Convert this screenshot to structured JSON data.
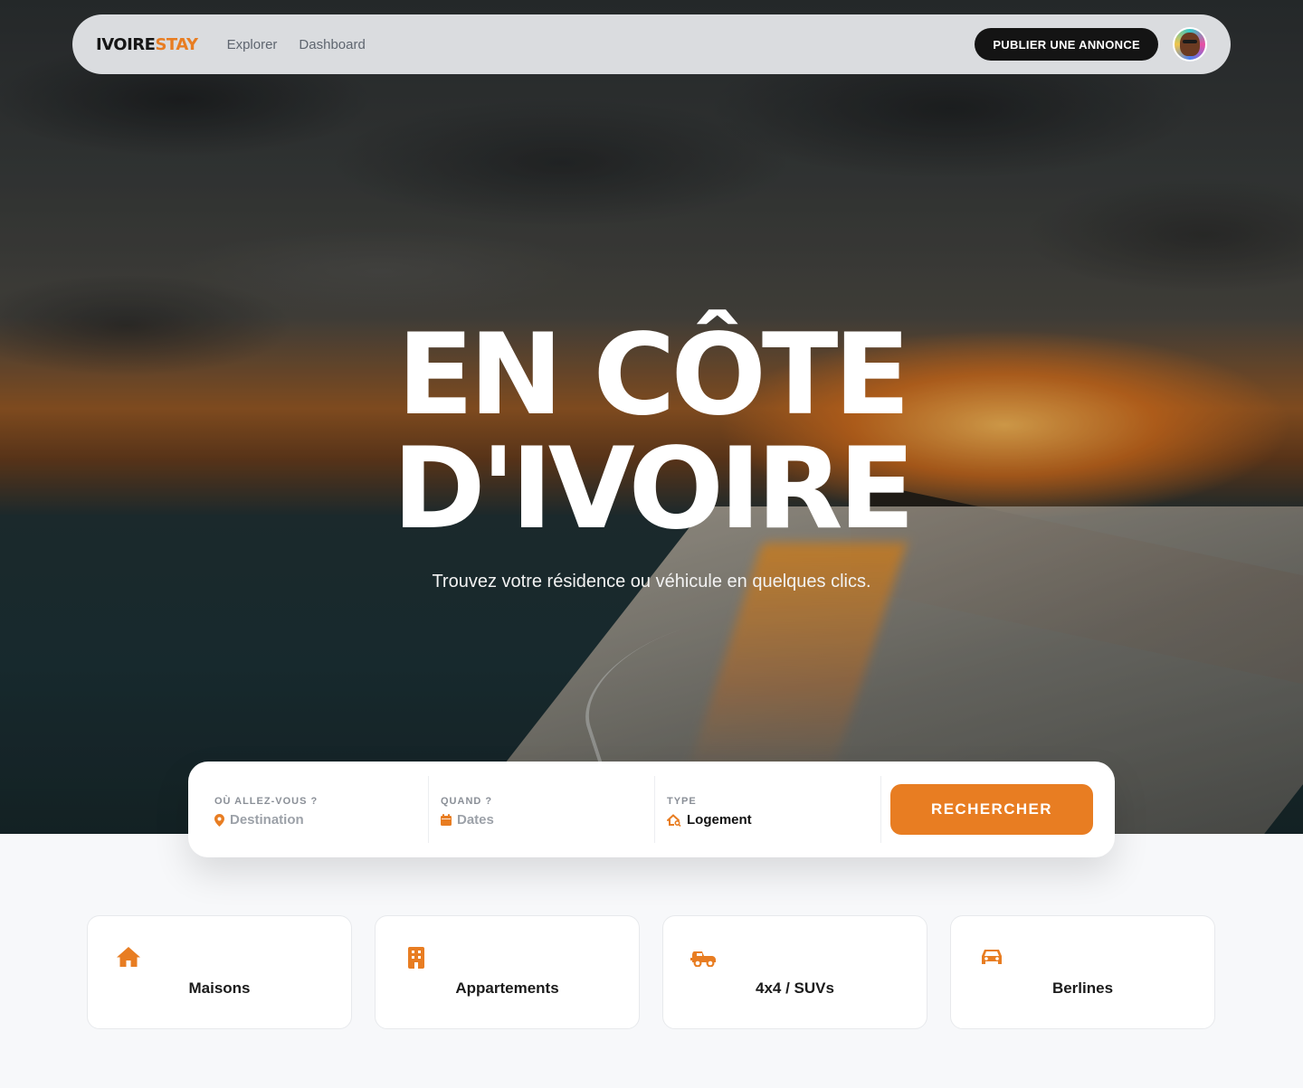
{
  "brand": {
    "part1": "IVOIRE",
    "part2": "STAY",
    "accent": "#e87d22"
  },
  "nav": {
    "links": [
      {
        "label": "Explorer"
      },
      {
        "label": "Dashboard"
      }
    ],
    "publish_label": "PUBLIER UNE ANNONCE",
    "avatar_icon": "user-avatar"
  },
  "hero": {
    "title_line1": "EN CÔTE",
    "title_line2": "D'IVOIRE",
    "subtitle": "Trouvez votre résidence ou véhicule en quelques clics."
  },
  "search": {
    "where_label": "OÙ ALLEZ-VOUS ?",
    "where_placeholder": "Destination",
    "where_icon": "map-pin-icon",
    "when_label": "QUAND ?",
    "when_placeholder": "Dates",
    "when_icon": "calendar-icon",
    "type_label": "TYPE",
    "type_value": "Logement",
    "type_icon": "house-search-icon",
    "button_label": "RECHERCHER"
  },
  "categories": [
    {
      "label": "Maisons",
      "icon": "house-icon"
    },
    {
      "label": "Appartements",
      "icon": "building-icon"
    },
    {
      "label": "4x4 / SUVs",
      "icon": "truck-icon"
    },
    {
      "label": "Berlines",
      "icon": "car-icon"
    }
  ]
}
